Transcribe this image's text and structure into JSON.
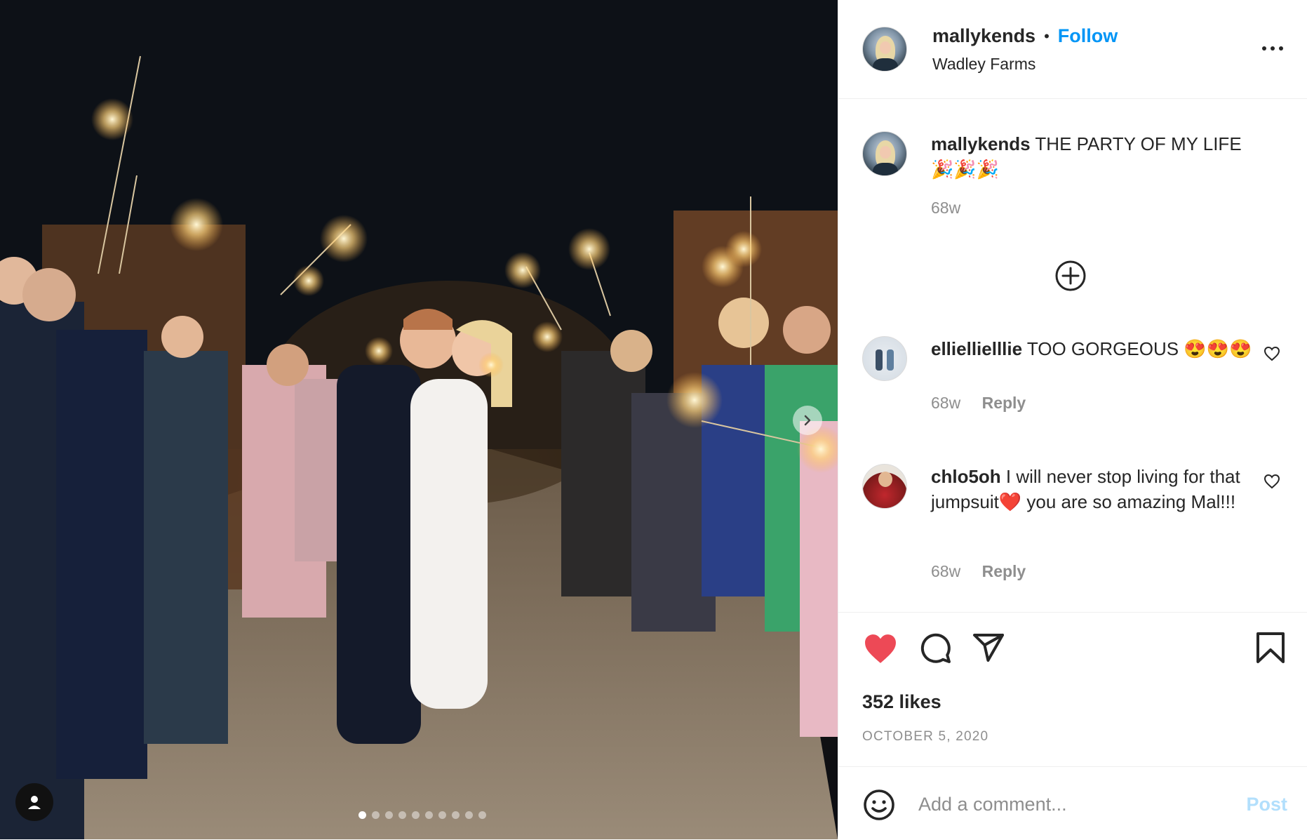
{
  "header": {
    "username": "mallykends",
    "separator": "•",
    "follow_label": "Follow",
    "location": "Wadley Farms",
    "more_icon": "more-horizontal-icon"
  },
  "caption": {
    "username": "mallykends",
    "text": "THE PARTY OF MY LIFE",
    "emoji": "🎉🎉🎉",
    "age": "68w"
  },
  "load_more_icon": "plus-circle-icon",
  "comments": [
    {
      "username": "elliellielllie",
      "text": "TOO GORGEOUS 😍😍😍",
      "age": "68w",
      "reply_label": "Reply"
    },
    {
      "username": "chlo5oh",
      "text": "I will never stop living for that jumpsuit❤️ you are so amazing Mal!!!",
      "age": "68w",
      "reply_label": "Reply"
    }
  ],
  "actions": {
    "liked": true,
    "like_color": "#ed4956",
    "likes_text": "352 likes",
    "date_text": "OCTOBER 5, 2020"
  },
  "add_comment": {
    "placeholder": "Add a comment...",
    "post_label": "Post",
    "emoji_icon": "smiley-icon"
  },
  "carousel": {
    "total": 10,
    "active_index": 0
  },
  "colors": {
    "accent": "#0095f6",
    "text": "#262626",
    "muted": "#8e8e8e",
    "post_disabled": "#b2dffc"
  }
}
